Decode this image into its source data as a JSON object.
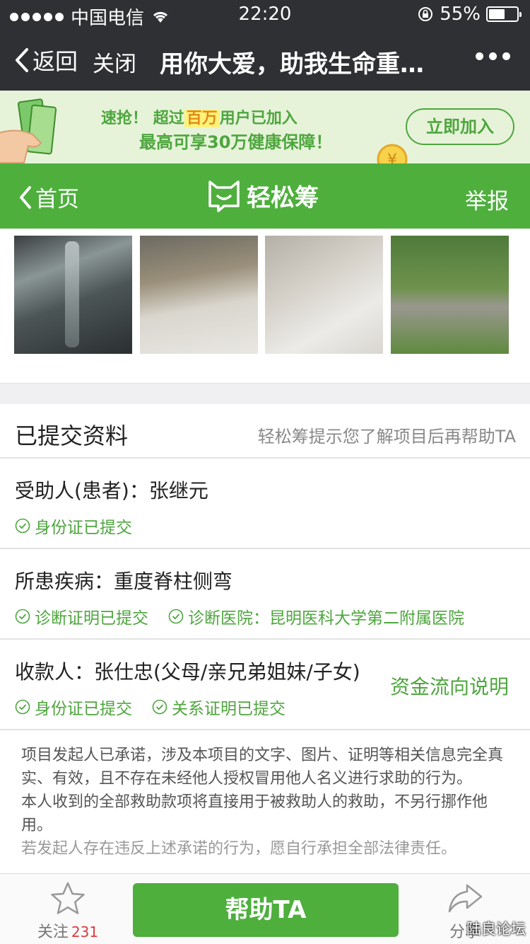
{
  "status_bar": {
    "carrier": "中国电信",
    "time": "22:20",
    "battery": "55%"
  },
  "nav": {
    "back_label": "返回",
    "close_label": "关闭",
    "title": "用你大爱，助我生命重…"
  },
  "promo": {
    "prefix": "速抢！",
    "text_before": "超过",
    "highlight": "百万",
    "text_after": "用户已加入",
    "line2": "最高可享30万健康保障！",
    "button": "立即加入"
  },
  "header": {
    "home_label": "首页",
    "brand": "轻松筹",
    "report_label": "举报"
  },
  "photos_count": 4,
  "info": {
    "title": "已提交资料",
    "hint": "轻松筹提示您了解项目后再帮助TA",
    "patient": {
      "label": "受助人(患者)：张继元",
      "tags": [
        "身份证已提交"
      ]
    },
    "disease": {
      "label": "所患疾病：重度脊柱侧弯",
      "tags": [
        "诊断证明已提交",
        "诊断医院：昆明医科大学第二附属医院"
      ]
    },
    "payee": {
      "label": "收款人：张仕忠(父母/亲兄弟姐妹/子女)",
      "tags": [
        "身份证已提交",
        "关系证明已提交"
      ],
      "link": "资金流向说明"
    },
    "statement": [
      "项目发起人已承诺，涉及本项目的文字、图片、证明等相关信息完全真实、有效，且不存在未经他人授权冒用他人名义进行求助的行为。",
      "本人收到的全部救助款项将直接用于被救助人的救助，不另行挪作他用。",
      "若发起人存在违反上述承诺的行为，愿自行承担全部法律责任。"
    ]
  },
  "bottom": {
    "follow_label": "关注",
    "follow_count": "231",
    "help_button": "帮助TA",
    "share_label": "分享",
    "watermark": "陆良论坛"
  },
  "colors": {
    "green": "#4eaf3d",
    "dark_bar": "#2f3033",
    "red_count": "#e0393e"
  }
}
